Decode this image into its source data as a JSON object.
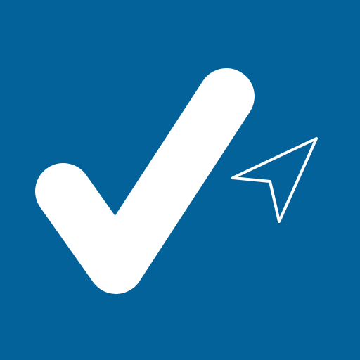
{
  "icon": {
    "name": "checkmark-with-navigation-arrow",
    "background_color": "#03629A",
    "checkmark_color": "#FFFFFF",
    "arrow_stroke_color": "#FFFFFF",
    "checkmark_icon": "checkmark-icon",
    "arrow_icon": "navigation-arrow-icon"
  }
}
